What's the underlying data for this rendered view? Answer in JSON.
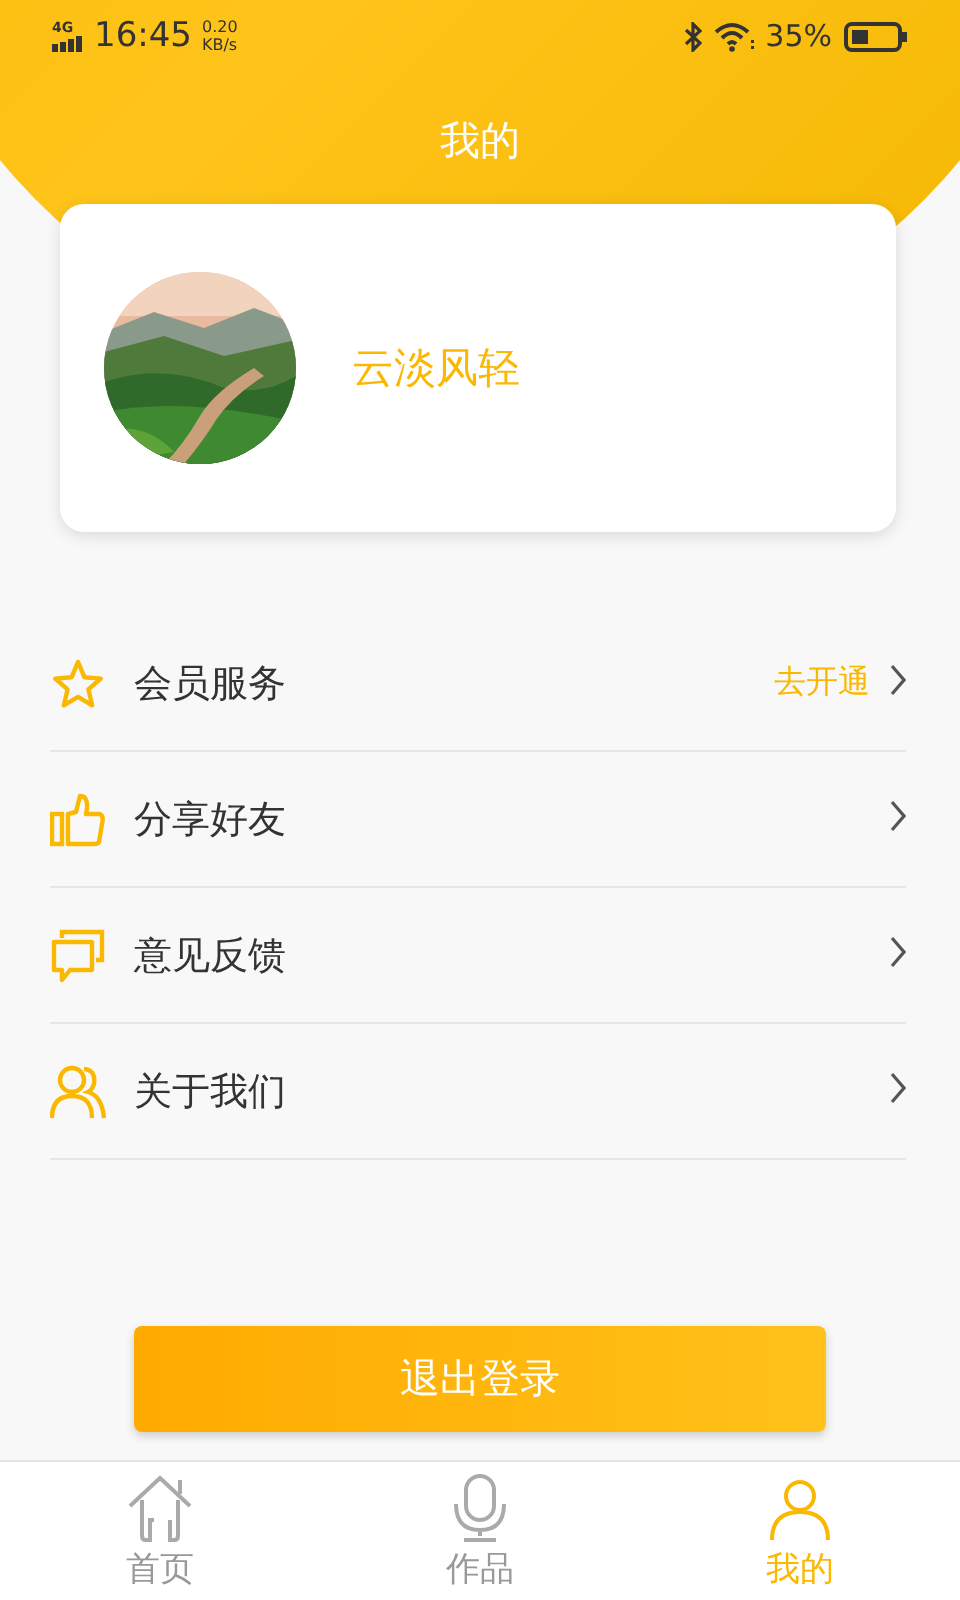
{
  "status_bar": {
    "network": "4G",
    "time": "16:45",
    "speed": "0.20",
    "speed_unit": "KB/s",
    "battery": "35%"
  },
  "header": {
    "title": "我的"
  },
  "profile": {
    "username": "云淡风轻"
  },
  "menu": [
    {
      "label": "会员服务",
      "action": "去开通"
    },
    {
      "label": "分享好友"
    },
    {
      "label": "意见反馈"
    },
    {
      "label": "关于我们"
    }
  ],
  "logout_button": "退出登录",
  "tabs": [
    {
      "label": "首页",
      "selected": false
    },
    {
      "label": "作品",
      "selected": false
    },
    {
      "label": "我的",
      "selected": true
    }
  ]
}
